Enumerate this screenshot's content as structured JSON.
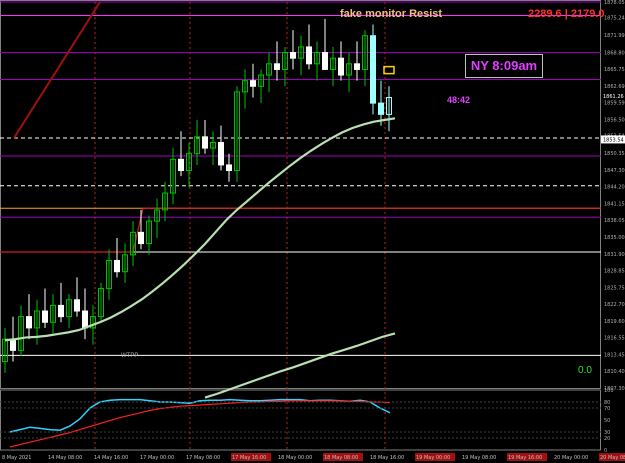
{
  "header": {
    "resist_label": "fake monitor Resist",
    "price_pair": "2289.6 | 2179.0",
    "ny_time": "NY 8:09am",
    "timer": "48:42",
    "oscillator_value": "0.0",
    "line_tag": "WTPP"
  },
  "colors": {
    "background": "#000000",
    "bull_candle": "#00c000",
    "bear_candle": "#ffffff",
    "highlight_candle": "#a0ffff",
    "moving_average": "#b8e0b0",
    "level_line": "#a000c0",
    "vertical_marker": "#c02020",
    "osc_fast": "#30d0ff",
    "osc_slow": "#ff2020"
  },
  "chart_data": {
    "type": "candlestick",
    "price_axis": {
      "ylim": [
        1809.3,
        1878.0
      ],
      "ticks": [
        "1878.05",
        "1875.24",
        "1871.99",
        "1868.80",
        "1865.75",
        "1862.69",
        "1859.59",
        "1856.50",
        "1853.54",
        "1850.35",
        "1847.30",
        "1844.20",
        "1841.15",
        "1838.05",
        "1835.00",
        "1831.90",
        "1828.85",
        "1825.75",
        "1822.70",
        "1819.60",
        "1816.55",
        "1813.45",
        "1810.40",
        "1807.30"
      ],
      "current_price": "1853.54",
      "last_price": "1861.26"
    },
    "oscillator_axis": {
      "ylim": [
        0,
        100
      ],
      "ticks": [
        "100",
        "80",
        "70",
        "50",
        "30",
        "20",
        "0"
      ]
    },
    "time_labels": [
      "8 May 2021",
      "14 May 08:00",
      "14 May 16:00",
      "17 May 00:00",
      "17 May 08:00",
      "17 May 16:00",
      "18 May 00:00",
      "18 May 08:00",
      "18 May 16:00",
      "19 May 00:00",
      "19 May 08:00",
      "19 May 16:00",
      "20 May 00:00",
      "20 May 08:00"
    ],
    "candles": [
      [
        1814,
        1820,
        1812,
        1818
      ],
      [
        1818,
        1822,
        1814,
        1816
      ],
      [
        1816,
        1824,
        1815,
        1822
      ],
      [
        1822,
        1826,
        1818,
        1820
      ],
      [
        1820,
        1825,
        1817,
        1823
      ],
      [
        1823,
        1827,
        1820,
        1821
      ],
      [
        1821,
        1826,
        1819,
        1824
      ],
      [
        1824,
        1828,
        1821,
        1822
      ],
      [
        1822,
        1826,
        1820,
        1825
      ],
      [
        1825,
        1829,
        1822,
        1823
      ],
      [
        1823,
        1827,
        1818,
        1820
      ],
      [
        1820,
        1824,
        1817,
        1822
      ],
      [
        1822,
        1828,
        1821,
        1827
      ],
      [
        1827,
        1834,
        1825,
        1832
      ],
      [
        1832,
        1836,
        1829,
        1830
      ],
      [
        1830,
        1835,
        1828,
        1833
      ],
      [
        1833,
        1839,
        1831,
        1837
      ],
      [
        1837,
        1841,
        1834,
        1835
      ],
      [
        1835,
        1840,
        1833,
        1839
      ],
      [
        1839,
        1843,
        1836,
        1841
      ],
      [
        1841,
        1846,
        1839,
        1844
      ],
      [
        1844,
        1852,
        1842,
        1850
      ],
      [
        1850,
        1855,
        1847,
        1848
      ],
      [
        1848,
        1853,
        1845,
        1851
      ],
      [
        1851,
        1857,
        1849,
        1854
      ],
      [
        1854,
        1857,
        1851,
        1852
      ],
      [
        1852,
        1855,
        1849,
        1853
      ],
      [
        1853,
        1856,
        1848,
        1849
      ],
      [
        1849,
        1851,
        1846,
        1848
      ],
      [
        1848,
        1863,
        1846,
        1862
      ],
      [
        1862,
        1866,
        1859,
        1864
      ],
      [
        1864,
        1867,
        1861,
        1863
      ],
      [
        1863,
        1866,
        1860,
        1865
      ],
      [
        1865,
        1869,
        1862,
        1867
      ],
      [
        1867,
        1871,
        1864,
        1866
      ],
      [
        1866,
        1870,
        1863,
        1869
      ],
      [
        1869,
        1873,
        1866,
        1868
      ],
      [
        1868,
        1872,
        1865,
        1870
      ],
      [
        1870,
        1874,
        1866,
        1867
      ],
      [
        1867,
        1871,
        1864,
        1869
      ],
      [
        1869,
        1875,
        1867,
        1866
      ],
      [
        1866,
        1870,
        1863,
        1868
      ],
      [
        1868,
        1871,
        1864,
        1865
      ],
      [
        1865,
        1869,
        1862,
        1867
      ],
      [
        1867,
        1871,
        1864,
        1866
      ],
      [
        1866,
        1873,
        1863,
        1872
      ],
      [
        1872,
        1874,
        1858,
        1860
      ],
      [
        1860,
        1864,
        1856,
        1858
      ],
      [
        1858,
        1863,
        1855,
        1861
      ]
    ],
    "moving_average": [
      1817.8,
      1818.0,
      1818.3,
      1818.4,
      1818.6,
      1818.9,
      1819.2,
      1819.6,
      1820.3,
      1821.0,
      1821.8,
      1822.8,
      1823.9,
      1825.1,
      1826.5,
      1828.0,
      1829.6,
      1831.3,
      1833.1,
      1835.0,
      1837.1,
      1839.2,
      1841.0,
      1842.6,
      1844.2,
      1845.8,
      1847.3,
      1848.8,
      1850.2,
      1851.5,
      1852.7,
      1853.8,
      1854.8,
      1855.6,
      1856.2,
      1856.7,
      1857.0,
      1857.3
    ],
    "ma_lower_panel": [
      1807.6,
      1808.3,
      1809.1,
      1809.9,
      1810.7,
      1811.5,
      1812.3,
      1813.0,
      1813.8,
      1814.6,
      1815.4,
      1816.1,
      1816.8,
      1817.6,
      1818.4,
      1819.0
    ],
    "levels": [
      {
        "price": 1878.0,
        "color": "#a000c0"
      },
      {
        "price": 1875.6,
        "color": "#ff30ff"
      },
      {
        "price": 1869.0,
        "color": "#a000c0"
      },
      {
        "price": 1864.2,
        "color": "#a000c0"
      },
      {
        "price": 1853.8,
        "color": "#ffffff",
        "dash": true
      },
      {
        "price": 1850.6,
        "color": "#a000c0"
      },
      {
        "price": 1845.3,
        "color": "#ffffff",
        "dash": true
      },
      {
        "price": 1841.3,
        "color": "#ffa020"
      },
      {
        "price": 1839.7,
        "color": "#a000c0"
      },
      {
        "price": 1833.5,
        "color": "#ffffff"
      },
      {
        "price": 1815.1,
        "color": "#ffffff"
      }
    ],
    "oscillator": {
      "fast": [
        30,
        34,
        38,
        36,
        34,
        33,
        40,
        52,
        70,
        80,
        83,
        84,
        84,
        84,
        82,
        80,
        80,
        79,
        78,
        82,
        83,
        83,
        84,
        83,
        82,
        82,
        83,
        84,
        84,
        84,
        82,
        83,
        83,
        82,
        81,
        83,
        80,
        70,
        62
      ],
      "slow": [
        5,
        9,
        13,
        17,
        21,
        25,
        29,
        34,
        39,
        44,
        49,
        54,
        58,
        62,
        66,
        69,
        71,
        73,
        74,
        75,
        76,
        77,
        78,
        79,
        80,
        80,
        81,
        81,
        82,
        82,
        82,
        82,
        82,
        82,
        81,
        81,
        80,
        80,
        79
      ]
    }
  }
}
